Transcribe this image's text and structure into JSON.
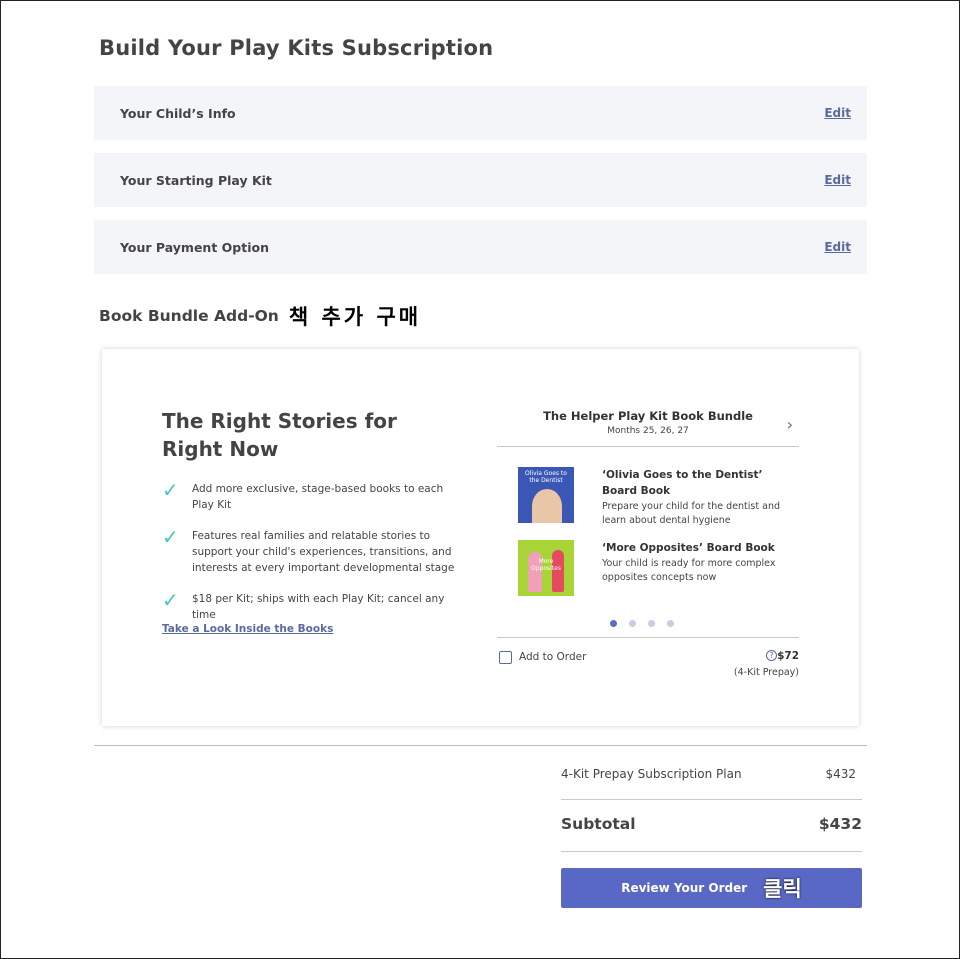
{
  "page": {
    "title": "Build Your Play Kits Subscription"
  },
  "steps": [
    {
      "label": "Your Child’s Info",
      "edit": "Edit"
    },
    {
      "label": "Your Starting Play Kit",
      "edit": "Edit"
    },
    {
      "label": "Your Payment Option",
      "edit": "Edit"
    }
  ],
  "addon": {
    "title": "Book Bundle Add-On",
    "annotation": "책 추가 구매",
    "heading": "The Right Stories for Right Now",
    "features": [
      "Add more exclusive, stage-based books to each Play Kit",
      "Features real families and relatable stories to support your child's experiences, transitions, and interests at every important developmental stage",
      "$18 per Kit; ships with each Play Kit; cancel any time"
    ],
    "check_glyph": "✓",
    "look_link": "Take a Look Inside the Books",
    "bundle": {
      "name": "The Helper Play Kit Book Bundle",
      "months": "Months 25, 26, 27",
      "next_icon": "›",
      "books": [
        {
          "cover_text": "Olivia Goes to the Dentist",
          "title": "‘Olivia Goes to the Dentist’ Board Book",
          "desc": "Prepare your child for the dentist and learn about dental hygiene"
        },
        {
          "cover_text": "More Opposites",
          "title": "‘More Opposites’ Board Book",
          "desc": "Your child is ready for more complex opposites concepts now"
        }
      ],
      "carousel": {
        "pages": 4,
        "active_page": 1
      },
      "add_label": "Add to Order",
      "help_icon": "?",
      "price": "$72",
      "price_note": "(4-Kit Prepay)"
    }
  },
  "summary": {
    "plan_label": "4-Kit Prepay Subscription Plan",
    "plan_price": "$432",
    "subtotal_label": "Subtotal",
    "subtotal_value": "$432",
    "review_button": "Review Your Order",
    "review_annotation": "클릭"
  },
  "colors": {
    "accent": "#5868c4",
    "check": "#45c7c0",
    "link": "#5a6a9e",
    "row_bg": "#f4f5f9"
  }
}
